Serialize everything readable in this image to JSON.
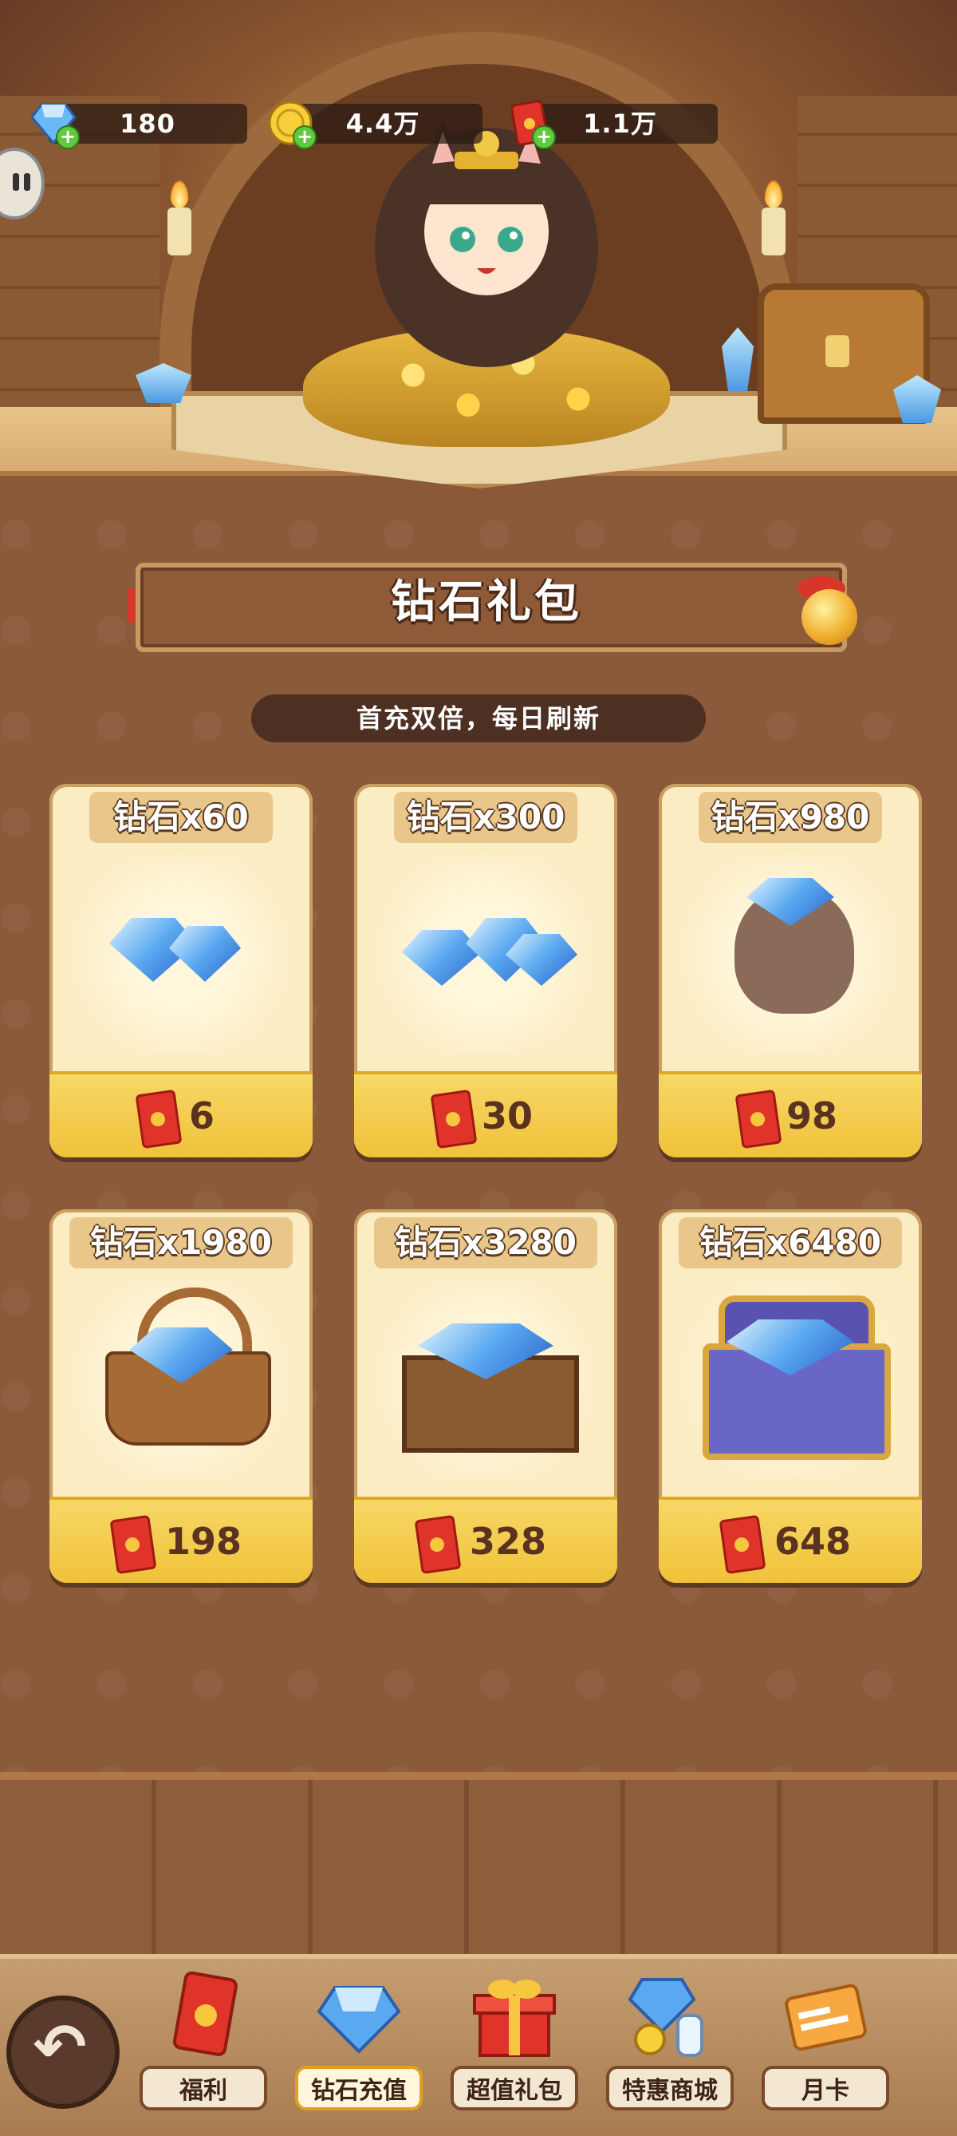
{
  "colors": {
    "accent": "#f0c23a",
    "panel": "#8a5a3a",
    "title_text": "#ffffff",
    "price_text": "#5a3220",
    "envelope": "#e0342a"
  },
  "resources": [
    {
      "icon": "diamond-icon",
      "value": "180"
    },
    {
      "icon": "gold-coin-icon",
      "value": "4.4万"
    },
    {
      "icon": "red-envelope-icon",
      "value": "1.1万"
    }
  ],
  "section": {
    "title": "钻石礼包",
    "subtitle": "首充双倍，每日刷新"
  },
  "packages": [
    {
      "label": "钻石x60",
      "price": "6",
      "art": "small-diamonds-icon"
    },
    {
      "label": "钻石x300",
      "price": "30",
      "art": "diamond-pile-icon"
    },
    {
      "label": "钻石x980",
      "price": "98",
      "art": "diamond-bag-icon"
    },
    {
      "label": "钻石x1980",
      "price": "198",
      "art": "diamond-basket-icon"
    },
    {
      "label": "钻石x3280",
      "price": "328",
      "art": "diamond-crate-icon"
    },
    {
      "label": "钻石x6480",
      "price": "648",
      "art": "diamond-treasure-chest-icon"
    }
  ],
  "nav": [
    {
      "label": "福利",
      "icon": "red-envelope-icon",
      "active": false
    },
    {
      "label": "钻石充值",
      "icon": "diamond-icon",
      "active": true
    },
    {
      "label": "超值礼包",
      "icon": "gift-box-icon",
      "active": false
    },
    {
      "label": "特惠商城",
      "icon": "shop-goods-icon",
      "active": false
    },
    {
      "label": "月卡",
      "icon": "monthly-card-icon",
      "active": false
    }
  ]
}
